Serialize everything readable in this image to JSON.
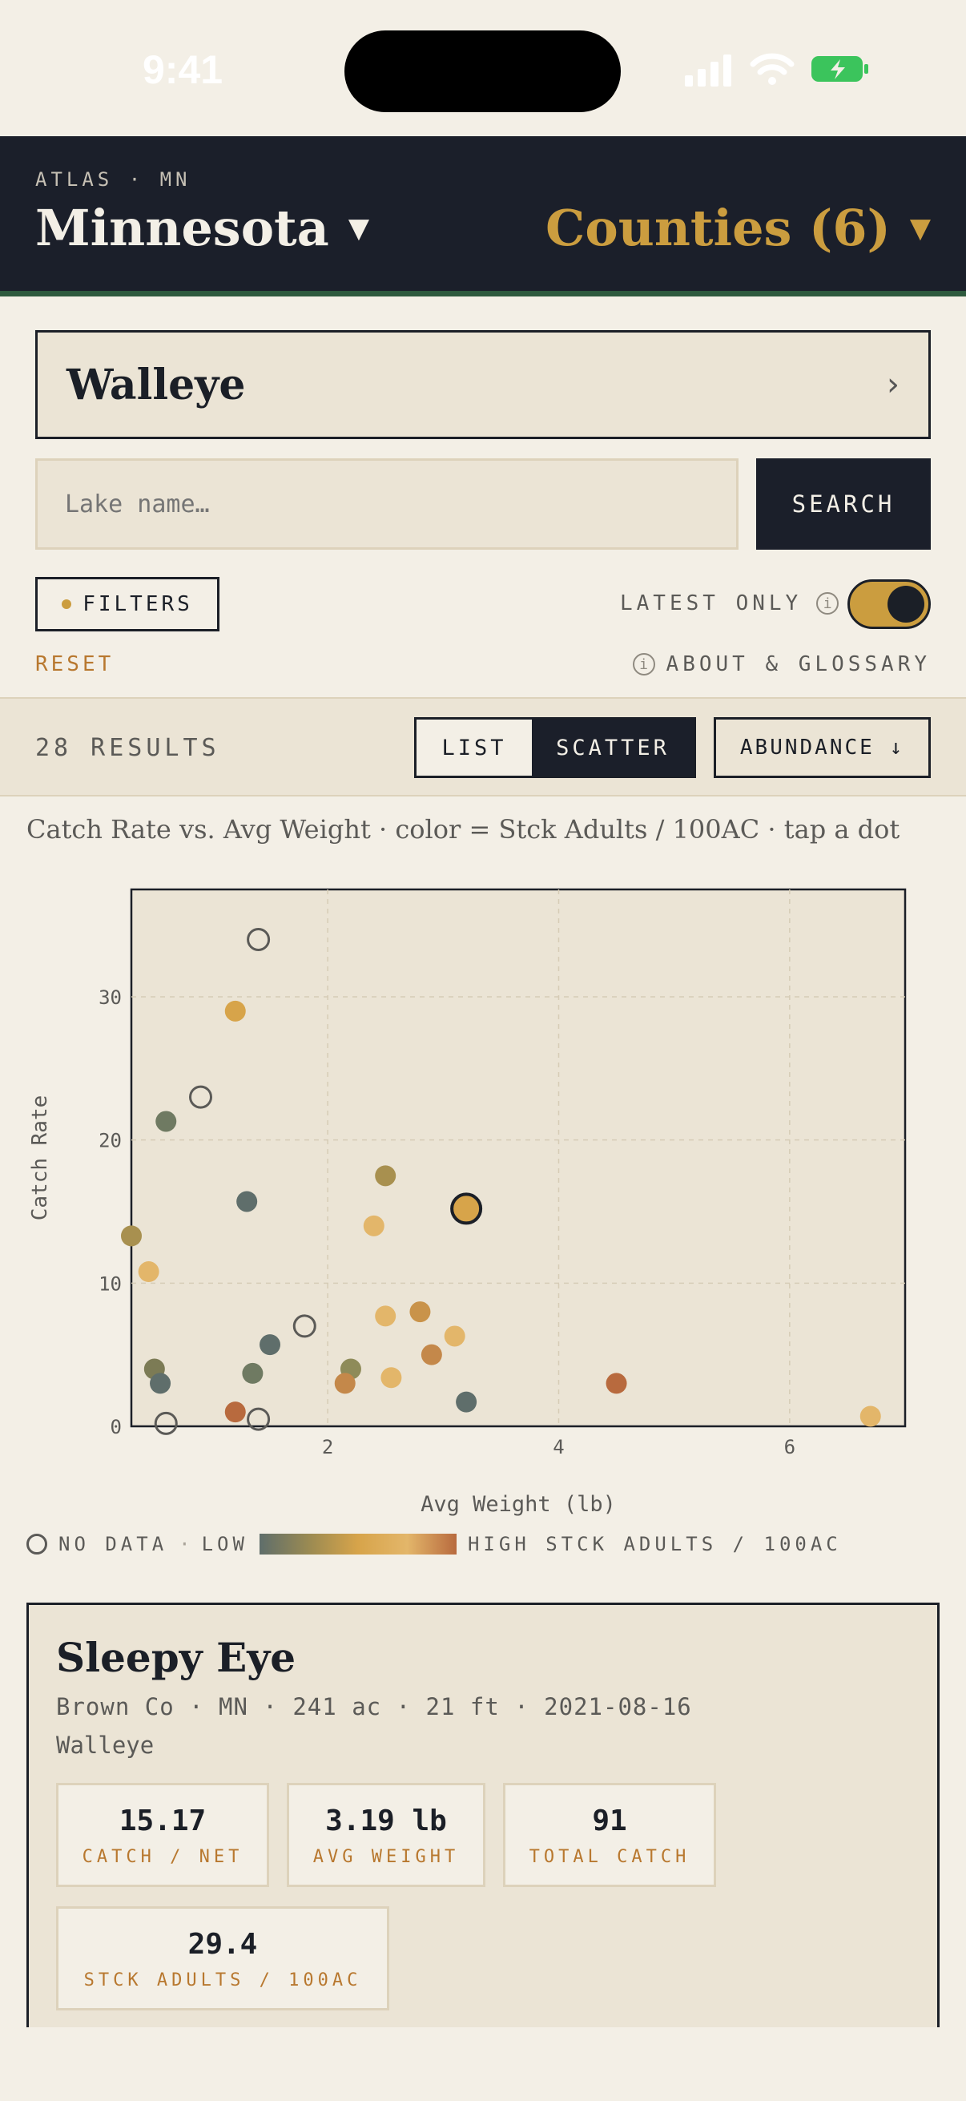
{
  "status_bar": {
    "time": "9:41"
  },
  "header": {
    "eyebrow": "ATLAS · MN",
    "state": "Minnesota",
    "counties": "Counties (6)"
  },
  "species": {
    "name": "Walleye"
  },
  "search": {
    "placeholder": "Lake name…",
    "button": "SEARCH"
  },
  "filters": {
    "filters_label": "FILTERS",
    "latest_only_label": "LATEST ONLY",
    "latest_only_on": true,
    "reset_label": "RESET",
    "about_label": "ABOUT & GLOSSARY"
  },
  "results": {
    "count_label": "28 RESULTS",
    "view_list": "LIST",
    "view_scatter": "SCATTER",
    "active_view": "SCATTER",
    "sort_label": "ABUNDANCE ↓"
  },
  "caption": "Catch Rate vs. Avg Weight · color = Stck Adults / 100AC · tap a dot",
  "chart_data": {
    "type": "scatter",
    "xlabel": "Avg Weight (lb)",
    "ylabel": "Catch Rate",
    "xlim": [
      0.3,
      7.0
    ],
    "ylim": [
      0,
      37.5
    ],
    "xticks": [
      2,
      4,
      6
    ],
    "yticks": [
      0,
      10,
      20,
      30
    ],
    "grid": true,
    "points": [
      {
        "x": 1.4,
        "y": 34.0,
        "color": null
      },
      {
        "x": 1.2,
        "y": 29.0,
        "color": "#d7a44a"
      },
      {
        "x": 0.6,
        "y": 21.3,
        "color": "#6f7a62"
      },
      {
        "x": 0.9,
        "y": 23.0,
        "color": null
      },
      {
        "x": 1.3,
        "y": 15.7,
        "color": "#5f6e6b"
      },
      {
        "x": 2.5,
        "y": 17.5,
        "color": "#a8904f"
      },
      {
        "x": 2.4,
        "y": 14.0,
        "color": "#e3b66a"
      },
      {
        "x": 3.2,
        "y": 15.2,
        "color": "#d7a44a",
        "selected": true
      },
      {
        "x": 0.3,
        "y": 13.3,
        "color": "#a8904f"
      },
      {
        "x": 0.45,
        "y": 10.8,
        "color": "#e3b66a"
      },
      {
        "x": 1.8,
        "y": 7.0,
        "color": null
      },
      {
        "x": 1.5,
        "y": 5.7,
        "color": "#5f6e6b"
      },
      {
        "x": 2.5,
        "y": 7.7,
        "color": "#e3b66a"
      },
      {
        "x": 2.8,
        "y": 8.0,
        "color": "#c9934a"
      },
      {
        "x": 3.1,
        "y": 6.3,
        "color": "#e3b66a"
      },
      {
        "x": 2.9,
        "y": 5.0,
        "color": "#c4884a"
      },
      {
        "x": 0.5,
        "y": 4.0,
        "color": "#7c7b55"
      },
      {
        "x": 0.55,
        "y": 3.0,
        "color": "#5f6e6b"
      },
      {
        "x": 1.35,
        "y": 3.7,
        "color": "#6f7a62"
      },
      {
        "x": 2.2,
        "y": 4.0,
        "color": "#8e8b59"
      },
      {
        "x": 2.15,
        "y": 3.0,
        "color": "#c4884a"
      },
      {
        "x": 2.55,
        "y": 3.4,
        "color": "#e3b66a"
      },
      {
        "x": 4.5,
        "y": 3.0,
        "color": "#b86a3e"
      },
      {
        "x": 3.2,
        "y": 1.7,
        "color": "#5f6e6b"
      },
      {
        "x": 1.2,
        "y": 1.0,
        "color": "#b86a3e"
      },
      {
        "x": 0.6,
        "y": 0.2,
        "color": null
      },
      {
        "x": 1.4,
        "y": 0.5,
        "color": null
      },
      {
        "x": 6.7,
        "y": 0.7,
        "color": "#e3b66a"
      }
    ]
  },
  "legend": {
    "no_data": "NO DATA",
    "low": "LOW",
    "high": "HIGH STCK ADULTS / 100AC"
  },
  "detail": {
    "title": "Sleepy Eye",
    "meta": "Brown Co · MN · 241 ac · 21 ft · 2021-08-16",
    "species": "Walleye",
    "stats": [
      {
        "value": "15.17",
        "label": "CATCH / NET"
      },
      {
        "value": "3.19 lb",
        "label": "AVG WEIGHT"
      },
      {
        "value": "91",
        "label": "TOTAL CATCH"
      },
      {
        "value": "29.4",
        "label": "STCK ADULTS / 100AC"
      }
    ]
  }
}
